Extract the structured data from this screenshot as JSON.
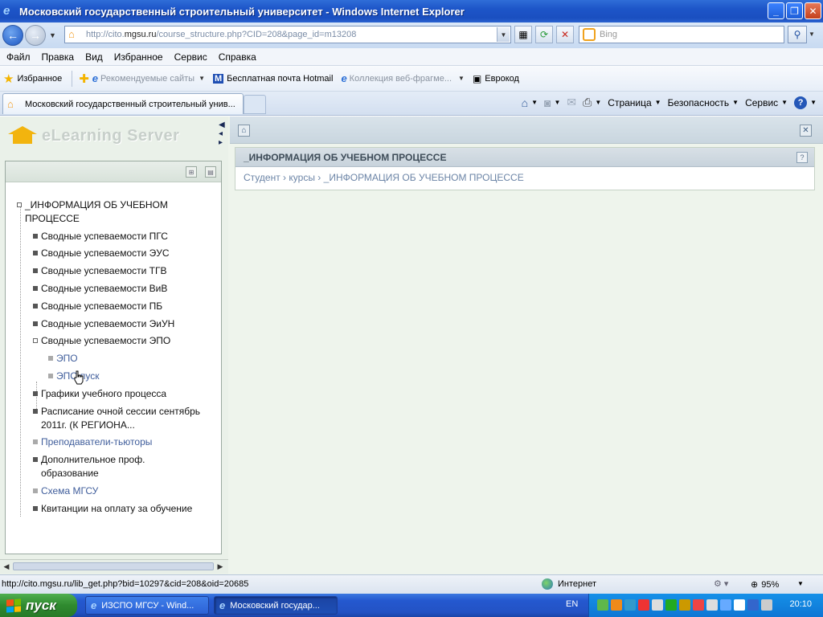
{
  "window": {
    "title": "Московский государственный строительный университет - Windows Internet Explorer"
  },
  "address": {
    "url_prefix": "http://cito.",
    "url_domain": "mgsu.ru",
    "url_path": "/course_structure.php?CID=208&page_id=m13208"
  },
  "search": {
    "placeholder": "Bing"
  },
  "menu": {
    "items": [
      "Файл",
      "Правка",
      "Вид",
      "Избранное",
      "Сервис",
      "Справка"
    ]
  },
  "favorites": {
    "label": "Избранное",
    "items": [
      {
        "label": "Рекомендуемые сайты",
        "grey": true
      },
      {
        "label": "Бесплатная почта Hotmail",
        "grey": false
      },
      {
        "label": "Коллекция веб-фрагме...",
        "grey": true
      },
      {
        "label": "Еврокод",
        "grey": false
      }
    ]
  },
  "tab": {
    "label": "Московский государственный строительный унив..."
  },
  "commands": {
    "page": "Страница",
    "security": "Безопасность",
    "tools": "Сервис"
  },
  "left": {
    "logo_text": "eLearning Server",
    "tree": {
      "root": "_ИНФОРМАЦИЯ ОБ УЧЕБНОМ ПРОЦЕССЕ",
      "items": [
        "Сводные успеваемости ПГС",
        "Сводные успеваемости ЭУС",
        "Сводные успеваемости ТГВ",
        "Сводные успеваемости ВиВ",
        "Сводные успеваемости ПБ",
        "Сводные успеваемости ЭиУН",
        "Сводные успеваемости ЭПО",
        "ЭПО",
        "ЭПО пуск",
        "Графики учебного процесса",
        "Расписание очной сессии сентябрь 2011г. (К РЕГИОНА...",
        "Преподаватели-тьюторы",
        "Дополнительное проф. образование",
        "Схема МГСУ",
        "Квитанции на оплату за обучение"
      ]
    }
  },
  "right": {
    "header": "_ИНФОРМАЦИЯ ОБ УЧЕБНОМ ПРОЦЕССЕ",
    "breadcrumb": [
      "Студент",
      "курсы",
      "_ИНФОРМАЦИЯ ОБ УЧЕБНОМ ПРОЦЕССЕ"
    ],
    "crumb_sep": "›"
  },
  "status": {
    "url": "http://cito.mgsu.ru/lib_get.php?bid=10297&cid=208&oid=20685",
    "zone": "Интернет",
    "zoom": "95%"
  },
  "taskbar": {
    "start": "пуск",
    "tasks": [
      "ИЗСПО МГСУ - Wind...",
      "Московский государ..."
    ],
    "lang": "EN",
    "clock": "20:10"
  },
  "colors": {
    "accent": "#1d55c8",
    "link": "#3f5d9b",
    "start_green": "#2f8a2f"
  }
}
